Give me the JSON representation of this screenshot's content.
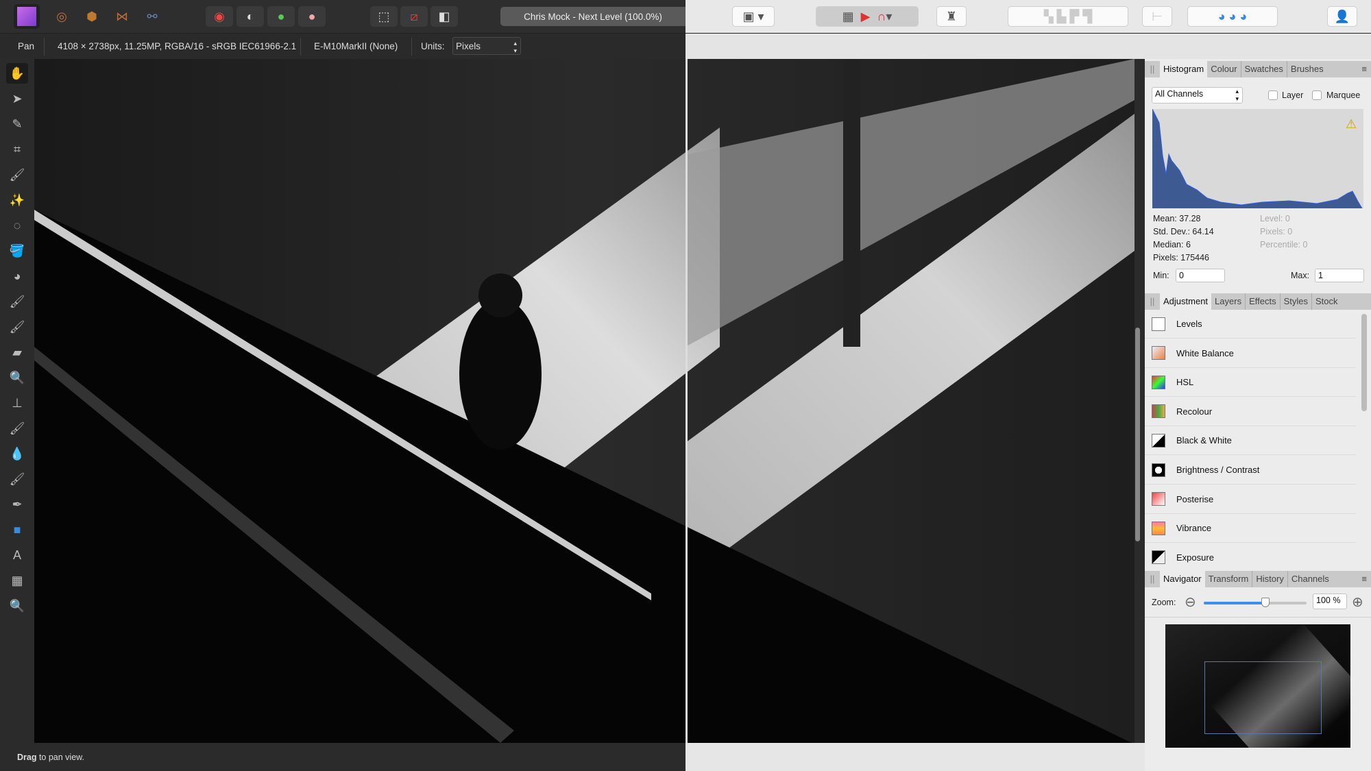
{
  "toolbar": {
    "personas": [
      "photo-persona",
      "liquify-persona",
      "develop-persona",
      "tone-mapping-persona",
      "export-persona"
    ],
    "document_title": "Chris Mock - Next Level (100.0%)"
  },
  "context": {
    "tool": "Pan",
    "doc_info": "4108 × 2738px, 11.25MP, RGBA/16 - sRGB IEC61966-2.1",
    "camera": "E-M10MarkII (None)",
    "units_label": "Units:",
    "units_value": "Pixels"
  },
  "tools": [
    "hand",
    "move",
    "colour-picker",
    "crop",
    "selection-brush",
    "flood-select",
    "marquee",
    "flood-fill",
    "colour-wheel",
    "paint-brush",
    "colour-replacement",
    "erase-brush",
    "dodge",
    "clone",
    "inpainting",
    "blur-brush",
    "smudge",
    "pen",
    "rectangle",
    "text",
    "mesh-warp",
    "zoom"
  ],
  "status": {
    "bold": "Drag",
    "text": " to pan view."
  },
  "histogram": {
    "tabs": [
      "Histogram",
      "Colour",
      "Swatches",
      "Brushes"
    ],
    "channel": "All Channels",
    "layer_label": "Layer",
    "marquee_label": "Marquee",
    "mean": "Mean: 37.28",
    "std": "Std. Dev.: 64.14",
    "median": "Median: 6",
    "pixels": "Pixels: 175446",
    "level": "Level: 0",
    "pix2": "Pixels: 0",
    "percentile": "Percentile: 0",
    "min_label": "Min:",
    "min": "0",
    "max_label": "Max:",
    "max": "1",
    "fill": "#3d5a93"
  },
  "adjustment": {
    "tabs": [
      "Adjustment",
      "Layers",
      "Effects",
      "Styles",
      "Stock"
    ],
    "items": [
      "Levels",
      "White Balance",
      "HSL",
      "Recolour",
      "Black & White",
      "Brightness / Contrast",
      "Posterise",
      "Vibrance",
      "Exposure"
    ]
  },
  "navigator": {
    "tabs": [
      "Navigator",
      "Transform",
      "History",
      "Channels"
    ],
    "zoom_label": "Zoom:",
    "zoom_value": "100 %",
    "zoom_fraction": 0.6
  }
}
